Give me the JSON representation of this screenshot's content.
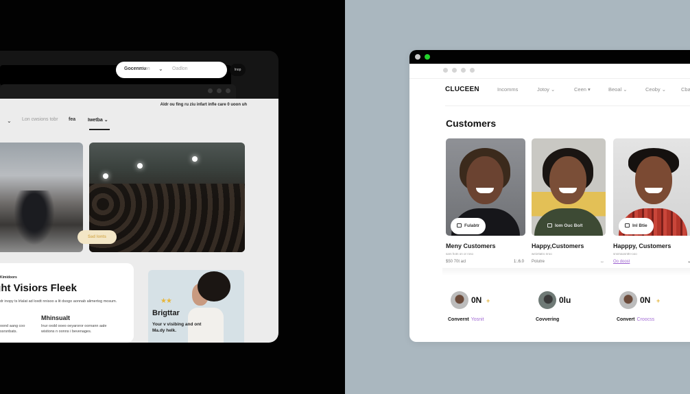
{
  "left_window": {
    "top_note": "Aldr ou fing ru ziu infart infle care 0 uoon uh",
    "nav": {
      "dropdown_chevron": "⌄",
      "item1": "Lon cwsions tobr",
      "item2": "fea",
      "item3": "Iwetba ⌄"
    },
    "search": {
      "category": "Gocenmu",
      "category_suffix": "/ on",
      "chevron": "⌄",
      "placeholder": "Oadlon",
      "go_label": "Inop"
    },
    "image_badge": "Sad lonts",
    "feature_card": {
      "eyebrow": "Kimidoors",
      "headline": "ight Visiors Fleek",
      "body": "dr inopy ts lrlalat ad loxdt nnisoo a lit dsogo aonnab alimertog mosum.",
      "subheading": "Mhinsualt",
      "col1": "oond aang coo ssrsnbats.",
      "col2": "Inur oxdd ooeo oeyaroror oornann aale wistions n oonns i bevenages."
    },
    "promo": {
      "stars": "★★",
      "title": "Brigttar",
      "text": "Your v visibing and ont Ma.dy helk."
    }
  },
  "right_window": {
    "brand": "CLUCEEN",
    "nav_items": [
      "Incomms",
      "Jotoy ⌄",
      "Ceen ▾",
      "Beoal ⌄",
      "Ceoby ⌄",
      "Cba"
    ],
    "page_title": "Customers",
    "customers": [
      {
        "pill_label": "Fulabtr",
        "name": "Meny Customers",
        "meta": "sars hotn on or roso",
        "left_value": "$50 70t acl",
        "right_value": "1:.6.0"
      },
      {
        "pill_label": "Iom Ouc Bo/t",
        "name": "Happy,Customers",
        "meta": "weivrtatro nroo",
        "left_value": "Polutre",
        "right_value": "↔"
      },
      {
        "pill_label": "Inl Btie",
        "name": "Happpy, Customers",
        "meta": "snsrnaosnttn-ooo",
        "left_value": "Oo doost",
        "right_value": "⟷"
      }
    ],
    "stats": [
      {
        "value": "0N",
        "plus": "+",
        "label": "Convernt",
        "accent": "Yosnit"
      },
      {
        "value": "0lu",
        "plus": "",
        "label": "Covvering",
        "accent": ""
      },
      {
        "value": "0N",
        "plus": "+",
        "label": "Convert",
        "accent": "Croocss"
      }
    ]
  },
  "colors": {
    "left_background": "#020202",
    "right_background": "#aab7bf",
    "traffic_green": "#23d12c",
    "accent_purple": "#a26bd4",
    "star_yellow": "#e5b53b",
    "badge_cream": "#f3e6c6"
  }
}
